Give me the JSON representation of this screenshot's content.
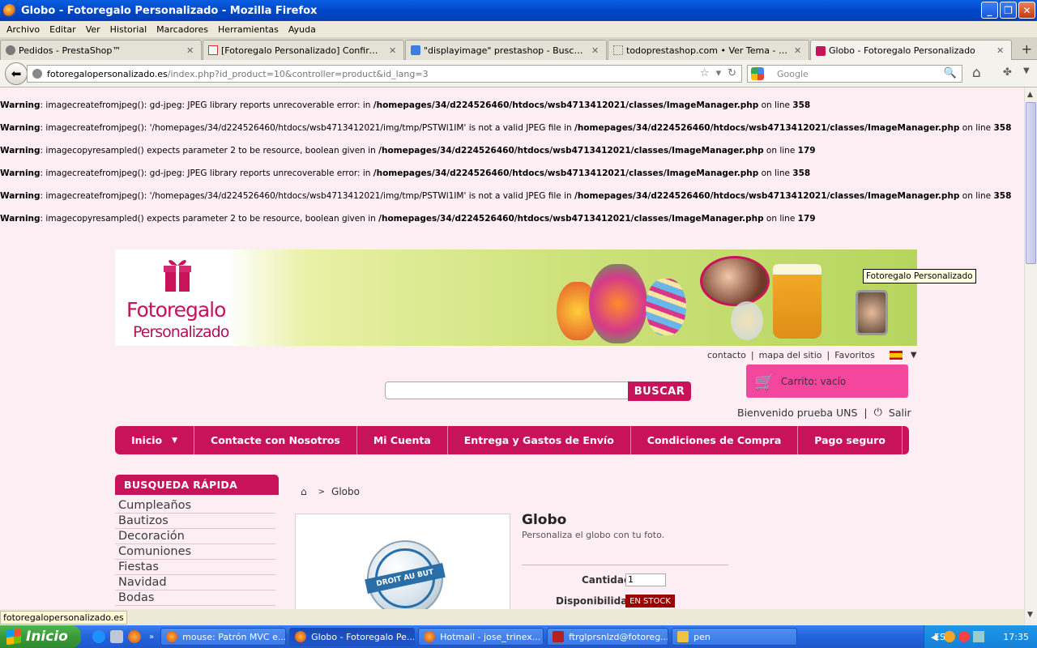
{
  "window": {
    "title": "Globo - Fotoregalo Personalizado - Mozilla Firefox"
  },
  "menu": [
    "Archivo",
    "Editar",
    "Ver",
    "Historial",
    "Marcadores",
    "Herramientas",
    "Ayuda"
  ],
  "tabs": [
    {
      "label": "Pedidos - PrestaShop™"
    },
    {
      "label": "[Fotoregalo Personalizado] Confirmación ..."
    },
    {
      "label": "\"displayimage\" prestashop - Buscar con G..."
    },
    {
      "label": "todoprestashop.com • Ver Tema - Proble..."
    },
    {
      "label": "Globo - Fotoregalo Personalizado"
    }
  ],
  "url": {
    "domain": "fotoregalopersonalizado.es",
    "path": "/index.php?id_product=10&controller=product&id_lang=3"
  },
  "search_engine": {
    "placeholder": "Google"
  },
  "warnings": [
    {
      "label": "Warning",
      "msg": ": imagecreatefromjpeg(): gd-jpeg: JPEG library reports unrecoverable error: in ",
      "file": "/homepages/34/d224526460/htdocs/wsb4713412021/classes/ImageManager.php",
      "on": " on line ",
      "line": "358"
    },
    {
      "label": "Warning",
      "msg": ": imagecreatefromjpeg(): '/homepages/34/d224526460/htdocs/wsb4713412021/img/tmp/PSTWl1IM' is not a valid JPEG file in ",
      "file": "/homepages/34/d224526460/htdocs/wsb4713412021/classes/ImageManager.php",
      "on": " on line ",
      "line": "358"
    },
    {
      "label": "Warning",
      "msg": ": imagecopyresampled() expects parameter 2 to be resource, boolean given in ",
      "file": "/homepages/34/d224526460/htdocs/wsb4713412021/classes/ImageManager.php",
      "on": " on line ",
      "line": "179"
    },
    {
      "label": "Warning",
      "msg": ": imagecreatefromjpeg(): gd-jpeg: JPEG library reports unrecoverable error: in ",
      "file": "/homepages/34/d224526460/htdocs/wsb4713412021/classes/ImageManager.php",
      "on": " on line ",
      "line": "358"
    },
    {
      "label": "Warning",
      "msg": ": imagecreatefromjpeg(): '/homepages/34/d224526460/htdocs/wsb4713412021/img/tmp/PSTWl1IM' is not a valid JPEG file in ",
      "file": "/homepages/34/d224526460/htdocs/wsb4713412021/classes/ImageManager.php",
      "on": " on line ",
      "line": "358"
    },
    {
      "label": "Warning",
      "msg": ": imagecopyresampled() expects parameter 2 to be resource, boolean given in ",
      "file": "/homepages/34/d224526460/htdocs/wsb4713412021/classes/ImageManager.php",
      "on": " on line ",
      "line": "179"
    }
  ],
  "banner": {
    "logo_line1": "Fotoregalo",
    "logo_line2": "Personalizado",
    "tooltip": "Fotoregalo Personalizado"
  },
  "toplinks": {
    "contacto": "contacto",
    "sitemap": "mapa del sitio",
    "favoritos": "Favoritos",
    "sep": "|"
  },
  "search": {
    "button": "BUSCAR"
  },
  "cart": {
    "label": "Carrito: vacío"
  },
  "user": {
    "welcome": "Bienvenido prueba UNS",
    "logout": "Salir",
    "sep": "|"
  },
  "nav": [
    "Inicio",
    "Contacte con Nosotros",
    "Mi Cuenta",
    "Entrega y Gastos de Envío",
    "Condiciones de Compra",
    "Pago seguro"
  ],
  "sidebar": {
    "title": "BUSQUEDA RÁPIDA",
    "categories": [
      "Cumpleaños",
      "Bautizos",
      "Decoración",
      "Comuniones",
      "Fiestas",
      "Navidad",
      "Bodas"
    ]
  },
  "breadcrumb": {
    "sep": ">",
    "current": "Globo"
  },
  "product": {
    "title": "Globo",
    "description": "Personaliza el globo con tu foto.",
    "image_text": "DROIT AU BUT",
    "qty_label": "Cantidad",
    "qty_value": "1",
    "avail_label": "Disponibilidad:",
    "stock": "EN STOCK"
  },
  "status": {
    "text": "fotoregalopersonalizado.es"
  },
  "taskbar": {
    "start": "Inicio",
    "tasks": [
      "mouse: Patrón MVC e...",
      "Globo - Fotoregalo Pe...",
      "Hotmail - jose_trinex...",
      "ftrglprsnlzd@fotoreg...",
      "pen"
    ],
    "lang": "ES",
    "clock": "17:35"
  },
  "colors": {
    "accent": "#c8125a",
    "cart": "#f2479c",
    "page_bg": "#fdeef3",
    "stock": "#9a0000"
  }
}
